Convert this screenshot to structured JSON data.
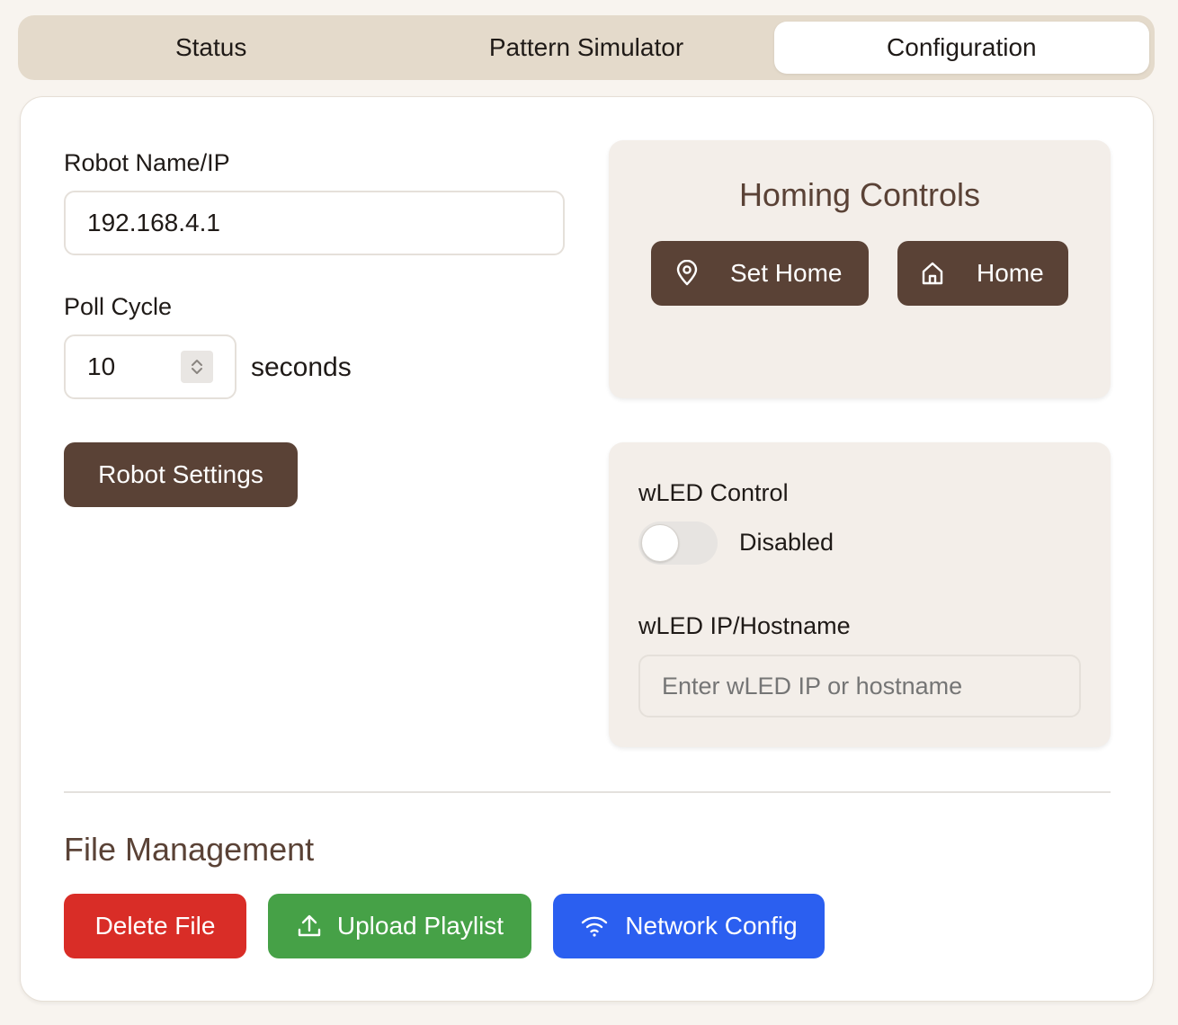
{
  "tabs": [
    {
      "label": "Status"
    },
    {
      "label": "Pattern Simulator"
    },
    {
      "label": "Configuration"
    }
  ],
  "robot": {
    "name_label": "Robot Name/IP",
    "name_value": "192.168.4.1",
    "poll_label": "Poll Cycle",
    "poll_value": "10",
    "poll_unit": "seconds",
    "settings_button": "Robot Settings"
  },
  "homing": {
    "title": "Homing Controls",
    "set_home_label": "Set Home",
    "set_home_icon": "map-pin-icon",
    "home_label": "Home",
    "home_icon": "house-icon"
  },
  "wled": {
    "control_label": "wLED Control",
    "toggle_state": "Disabled",
    "toggle_on": false,
    "ip_label": "wLED IP/Hostname",
    "ip_value": "",
    "ip_placeholder": "Enter wLED IP or hostname"
  },
  "file_management": {
    "title": "File Management",
    "delete_label": "Delete File",
    "upload_label": "Upload Playlist",
    "upload_icon": "upload-icon",
    "network_label": "Network Config",
    "network_icon": "wifi-icon"
  },
  "colors": {
    "brown": "#5a4236",
    "red": "#d92d27",
    "green": "#46a147",
    "blue": "#2b5ff0",
    "tabbar": "#e4dacb",
    "panel": "#f3eee9"
  }
}
